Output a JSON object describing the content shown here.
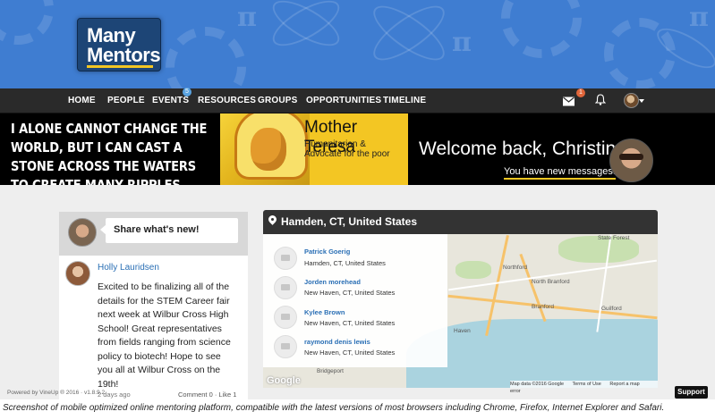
{
  "logo": {
    "line1": "Many",
    "line2": "Mentors"
  },
  "nav": {
    "items": [
      "HOME",
      "PEOPLE",
      "EVENTS",
      "RESOURCES",
      "GROUPS",
      "OPPORTUNITIES",
      "TIMELINE"
    ],
    "events_badge": "5",
    "mail_badge": "1",
    "icons": {
      "mail": "envelope-icon",
      "notifications": "bell-icon",
      "profile": "avatar"
    }
  },
  "quote_banner": {
    "quote": "I ALONE CANNOT CHANGE THE WORLD, BUT I CAN CAST A STONE ACROSS THE WATERS TO CREATE MANY RIPPLES.",
    "author": "Mother Teresa",
    "author_desc": "Humanitarian & Advocate for the poor",
    "welcome": "Welcome back, Christina",
    "messages_link": "You have new messages."
  },
  "feed": {
    "share_prompt": "Share what's new!",
    "post": {
      "author": "Holly Lauridsen",
      "text": "Excited to be finalizing all of the details for the STEM Career fair next week at Wilbur Cross High School! Great representatives from fields ranging from science policy to biotech! Hope to see you all at Wilbur Cross on the 19th!",
      "time": "2 days ago",
      "actions": "Comment 0 · Like 1"
    }
  },
  "map": {
    "location": "Hamden, CT, United States",
    "people": [
      {
        "name": "Patrick Goerig",
        "location": "Hamden, CT, United States"
      },
      {
        "name": "Jorden morehead",
        "location": "New Haven, CT, United States"
      },
      {
        "name": "Kylee Brown",
        "location": "New Haven, CT, United States"
      },
      {
        "name": "raymond denis lewis",
        "location": "New Haven, CT, United States"
      }
    ],
    "towns": [
      "State Forest",
      "Northford",
      "North Branford",
      "Branford",
      "Guilford",
      "Haven",
      "Bridgeport"
    ],
    "google": "Google",
    "footer": [
      "Map data ©2016 Google",
      "Terms of Use",
      "Report a map error"
    ]
  },
  "footer": {
    "powered_by": "Powered by VineUp ® 2016 · v1.8.9.2",
    "support": "Support",
    "caption": "Screenshot of mobile optimized online mentoring platform, compatible with the latest versions of most browsers including Chrome, Firefox, Internet Explorer and Safari."
  },
  "colors": {
    "banner_blue": "#3f7dd1",
    "nav_dark": "#2a2a2a",
    "accent_yellow": "#f3c623",
    "link_blue": "#2a6fb5"
  }
}
